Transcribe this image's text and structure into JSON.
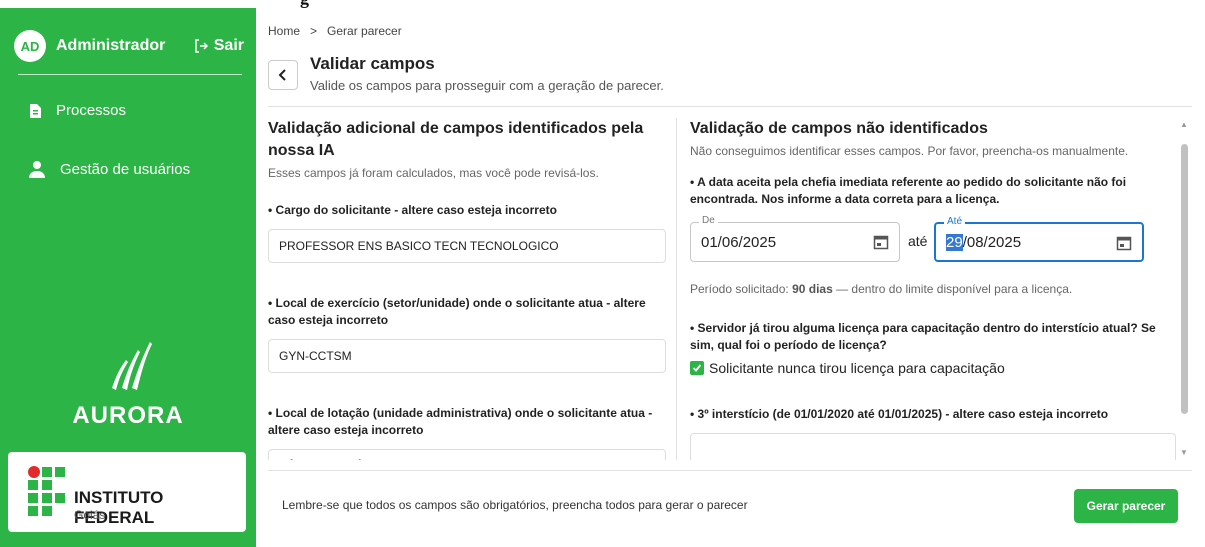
{
  "sidebar": {
    "avatar_initials": "AD",
    "username": "Administrador",
    "logout_label": "Sair",
    "nav": [
      {
        "label": "Processos",
        "icon": "document-icon"
      },
      {
        "label": "Gestão de usuários",
        "icon": "user-icon"
      }
    ],
    "brand_name": "AURORA",
    "institution_title": "INSTITUTO FEDERAL",
    "institution_sub": "Goiás",
    "accent_color": "#2db446"
  },
  "breadcrumb": {
    "home": "Home",
    "separator": ">",
    "current": "Gerar parecer"
  },
  "header": {
    "title": "Validar campos",
    "subtitle": "Valide os campos para prosseguir com a geração de parecer."
  },
  "left_section": {
    "title": "Validação adicional de campos identificados pela nossa IA",
    "subtitle": "Esses campos já foram calculados, mas você pode revisá-los.",
    "fields": [
      {
        "label": "• Cargo do solicitante - altere caso esteja incorreto",
        "value": "PROFESSOR ENS BASICO TECN TECNOLOGICO"
      },
      {
        "label": "• Local de exercício (setor/unidade) onde o solicitante atua - altere caso esteja incorreto",
        "value": "GYN-CCTSM"
      },
      {
        "label": "• Local de lotação (unidade administrativa) onde o solicitante atua - altere caso esteja incorreto",
        "value": "CÂMPUS GOIÂNIA"
      }
    ]
  },
  "right_section": {
    "title": "Validação de campos não identificados",
    "subtitle": "Não conseguimos identificar esses campos. Por favor, preencha-os manualmente.",
    "date_question": "• A data aceita pela chefia imediata referente ao pedido do solicitante não foi encontrada. Nos informe a data correta para a licença.",
    "date_from_label": "De",
    "date_from_value": "01/06/2025",
    "date_between": "até",
    "date_to_label": "Até",
    "date_to_selected": "29",
    "date_to_rest": "/08/2025",
    "period_prefix": "Período solicitado: ",
    "period_value": "90 dias",
    "period_suffix": " — dentro do limite disponível para a licença.",
    "license_question": "• Servidor já tirou alguma licença para capacitação dentro do interstício atual? Se sim, qual foi o período de licença?",
    "checkbox_label": "Solicitante nunca tirou licença para capacitação",
    "checkbox_checked": true,
    "interstice_label": "• 3º interstício (de 01/01/2020 até 01/01/2025) - altere caso esteja incorreto"
  },
  "footer": {
    "note": "Lembre-se que todos os campos são obrigatórios, preencha todos para gerar o parecer",
    "submit_label": "Gerar parecer"
  }
}
